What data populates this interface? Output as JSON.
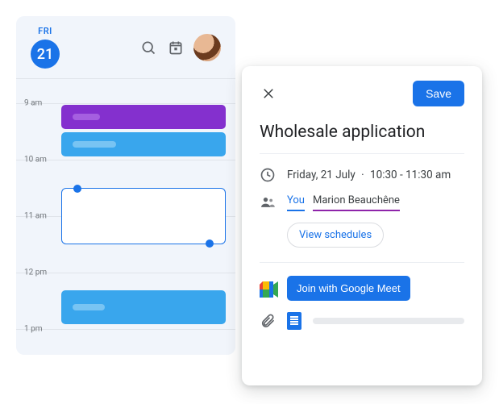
{
  "calendar": {
    "day_label": "FRI",
    "day_number": "21",
    "hours": [
      "9 am",
      "10 am",
      "11 am",
      "12 pm",
      "1 pm"
    ]
  },
  "panel": {
    "save_label": "Save",
    "title": "Wholesale application",
    "date_text": "Friday, 21 July",
    "time_text": "10:30 - 11:30 am",
    "guests": {
      "you": "You",
      "marion": "Marion Beauchêne"
    },
    "view_schedules_label": "View schedules",
    "join_meet_label": "Join with Google Meet"
  }
}
